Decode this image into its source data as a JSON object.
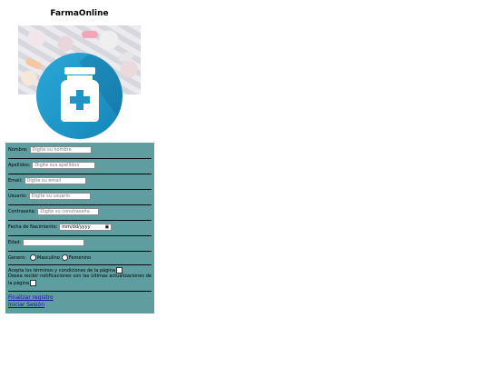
{
  "app": {
    "title": "FarmaOnline"
  },
  "form": {
    "nombre": {
      "label": "Nombre:",
      "placeholder": "Digite su nombre"
    },
    "apellidos": {
      "label": "Apellidos:",
      "placeholder": "Digite sus apellidos"
    },
    "email": {
      "label": "Email:",
      "placeholder": "Digite su email"
    },
    "usuario": {
      "label": "Usuario:",
      "placeholder": "Digite su usuario"
    },
    "contrasena": {
      "label": "Contraseña:",
      "placeholder": "Digite su constraseña"
    },
    "fecha": {
      "label": "Fecha de Nacimiento:",
      "placeholder": "mm/dd/yyyy"
    },
    "edad": {
      "label": "Edad:",
      "placeholder": ""
    },
    "genero": {
      "label": "Genero:",
      "options": [
        "Masculino",
        "Femenino"
      ]
    },
    "terminos": "Acepta los términos y condiciones de la página",
    "notificaciones": "Desea recibir notificaciones con las últimas actualizaciones de la página"
  },
  "links": {
    "finalizar": "Finalizar registro",
    "iniciar": "Iniciar Sesión"
  },
  "colors": {
    "form_bg": "#5f9ea0",
    "icon_circle": "#1e94c7",
    "link": "#1a0dab"
  },
  "icons": {
    "logo": "medicine-bottle-icon",
    "calendar": "calendar-icon"
  }
}
